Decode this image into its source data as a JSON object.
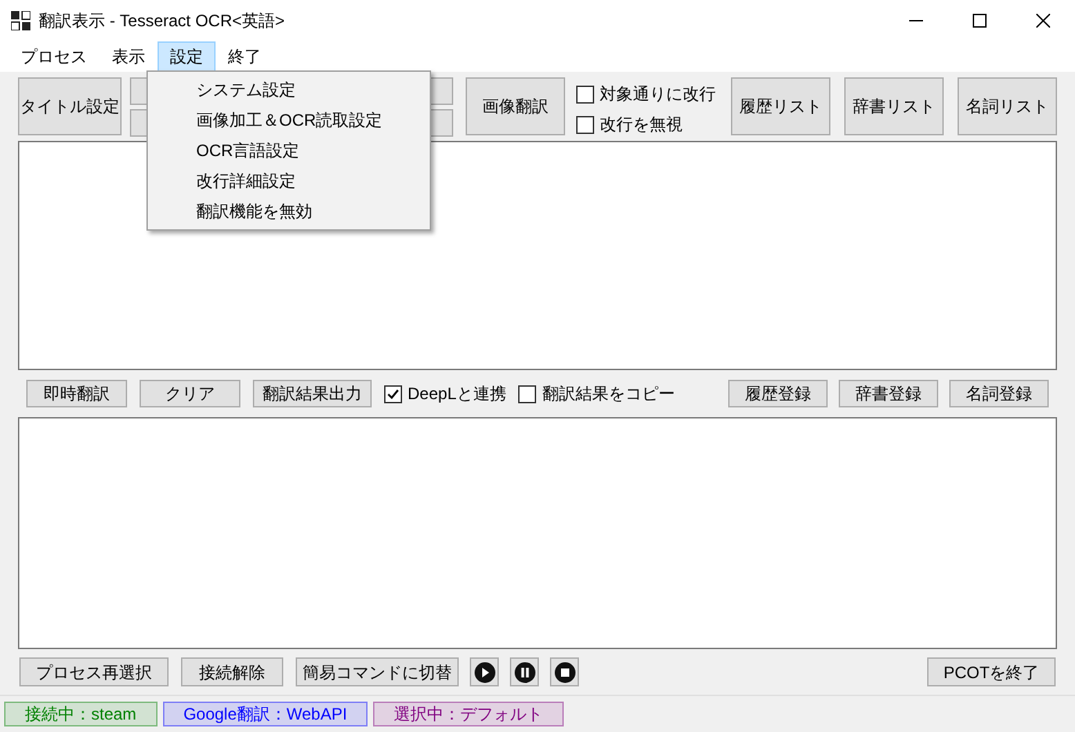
{
  "window": {
    "title": "翻訳表示 - Tesseract OCR<英語>"
  },
  "menu": [
    {
      "label": "プロセス",
      "selected": false
    },
    {
      "label": "表示",
      "selected": false
    },
    {
      "label": "設定",
      "selected": true
    },
    {
      "label": "終了",
      "selected": false
    }
  ],
  "dropdown": {
    "items": [
      "システム設定",
      "画像加工＆OCR読取設定",
      "OCR言語設定",
      "改行詳細設定",
      "翻訳機能を無効"
    ]
  },
  "top_toolbar": {
    "title_button": "タイトル設定",
    "image_button": "画像翻訳",
    "checkboxes": [
      {
        "label": "対象通りに改行",
        "checked": false
      },
      {
        "label": "改行を無視",
        "checked": false
      }
    ],
    "list_buttons": [
      "履歴リスト",
      "辞書リスト",
      "名詞リスト"
    ]
  },
  "middle_toolbar": {
    "buttons": [
      "即時翻訳",
      "クリア",
      "翻訳結果出力"
    ],
    "checkboxes": [
      {
        "label": "DeepLと連携",
        "checked": true
      },
      {
        "label": "翻訳結果をコピー",
        "checked": false
      }
    ],
    "register_buttons": [
      "履歴登録",
      "辞書登録",
      "名詞登録"
    ]
  },
  "bottom_toolbar": {
    "buttons": [
      "プロセス再選択",
      "接続解除",
      "簡易コマンドに切替"
    ],
    "media": [
      {
        "kind": "play"
      },
      {
        "kind": "pause"
      },
      {
        "kind": "stop"
      }
    ],
    "exit_button": "PCOTを終了"
  },
  "status_bar": [
    {
      "text": "接続中：steam",
      "color": "#008000"
    },
    {
      "text": "Google翻訳：WebAPI",
      "color": "#0000ff"
    },
    {
      "text": "選択中：デフォルト",
      "color": "#800080"
    }
  ]
}
